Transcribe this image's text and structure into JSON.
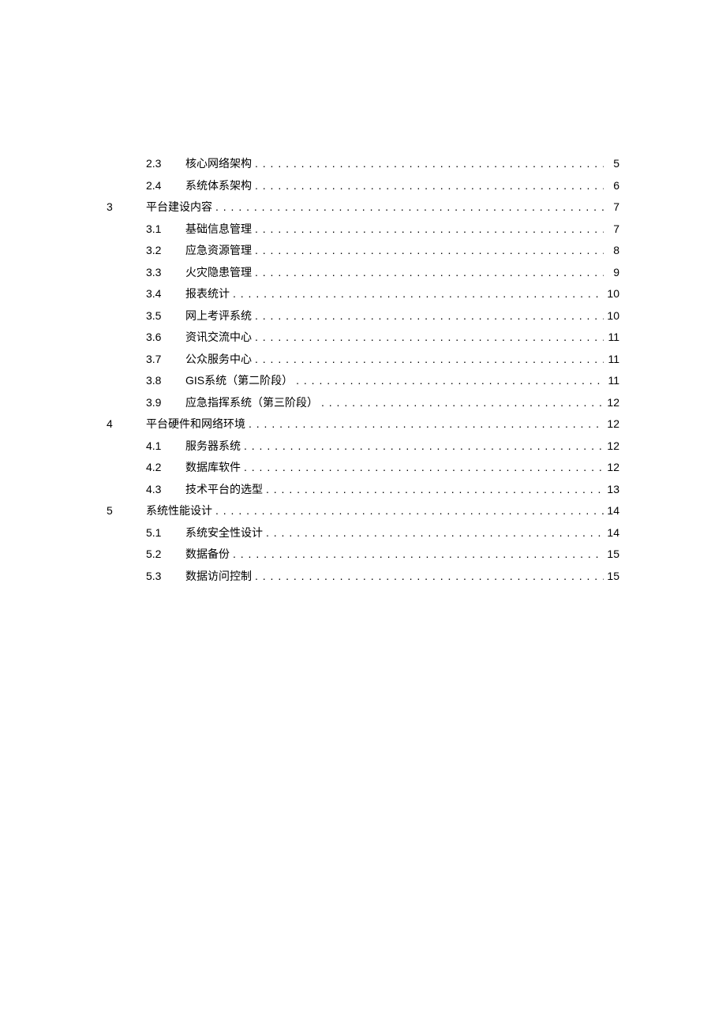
{
  "toc": [
    {
      "level": 2,
      "chapter": "",
      "section": "2.3",
      "title": "核心网络架构",
      "page": "5"
    },
    {
      "level": 2,
      "chapter": "",
      "section": "2.4",
      "title": "系统体系架构",
      "page": "6"
    },
    {
      "level": 1,
      "chapter": "3",
      "section": "",
      "title": "平台建设内容",
      "page": "7"
    },
    {
      "level": 2,
      "chapter": "",
      "section": "3.1",
      "title": "基础信息管理",
      "page": "7"
    },
    {
      "level": 2,
      "chapter": "",
      "section": "3.2",
      "title": "应急资源管理",
      "page": "8"
    },
    {
      "level": 2,
      "chapter": "",
      "section": "3.3",
      "title": "火灾隐患管理",
      "page": "9"
    },
    {
      "level": 2,
      "chapter": "",
      "section": "3.4",
      "title": "报表统计",
      "page": "10"
    },
    {
      "level": 2,
      "chapter": "",
      "section": "3.5",
      "title": "网上考评系统",
      "page": "10"
    },
    {
      "level": 2,
      "chapter": "",
      "section": "3.6",
      "title": "资讯交流中心",
      "page": "11"
    },
    {
      "level": 2,
      "chapter": "",
      "section": "3.7",
      "title": "公众服务中心",
      "page": "11"
    },
    {
      "level": 2,
      "chapter": "",
      "section": "3.8",
      "title": "GIS系统（第二阶段）",
      "page": "11"
    },
    {
      "level": 2,
      "chapter": "",
      "section": "3.9",
      "title": "应急指挥系统（第三阶段）",
      "page": "12"
    },
    {
      "level": 1,
      "chapter": "4",
      "section": "",
      "title": "平台硬件和网络环境",
      "page": "12"
    },
    {
      "level": 2,
      "chapter": "",
      "section": "4.1",
      "title": "服务器系统",
      "page": "12"
    },
    {
      "level": 2,
      "chapter": "",
      "section": "4.2",
      "title": "数据库软件",
      "page": "12"
    },
    {
      "level": 2,
      "chapter": "",
      "section": "4.3",
      "title": "技术平台的选型",
      "page": "13"
    },
    {
      "level": 1,
      "chapter": "5",
      "section": "",
      "title": "系统性能设计",
      "page": "14"
    },
    {
      "level": 2,
      "chapter": "",
      "section": "5.1",
      "title": "系统安全性设计",
      "page": "14"
    },
    {
      "level": 2,
      "chapter": "",
      "section": "5.2",
      "title": "数据备份",
      "page": "15"
    },
    {
      "level": 2,
      "chapter": "",
      "section": "5.3",
      "title": "数据访问控制",
      "page": "15"
    }
  ]
}
